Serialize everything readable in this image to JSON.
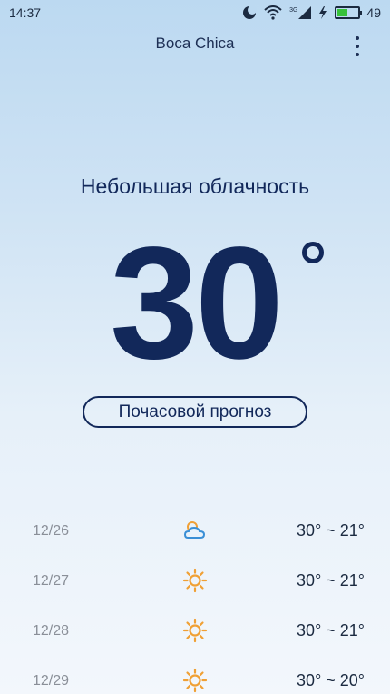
{
  "status_bar": {
    "time": "14:37",
    "network": "3G",
    "battery": "49",
    "battery_level": 0.49,
    "icons": [
      "moon-icon",
      "wifi-icon",
      "signal-icon",
      "charging-icon",
      "battery-icon"
    ]
  },
  "header": {
    "location": "Boca Chica",
    "menu_icon": "more-vertical-icon"
  },
  "current": {
    "condition": "Небольшая облачность",
    "temperature": "30"
  },
  "hourly_button": "Почасовой прогноз",
  "forecast": [
    {
      "date": "12/26",
      "icon": "partly-cloudy-icon",
      "range": "30° ~ 21°"
    },
    {
      "date": "12/27",
      "icon": "sun-icon",
      "range": "30° ~ 21°"
    },
    {
      "date": "12/28",
      "icon": "sun-icon",
      "range": "30° ~ 21°"
    },
    {
      "date": "12/29",
      "icon": "sun-icon",
      "range": "30° ~ 20°"
    }
  ],
  "colors": {
    "primary_text": "#12285a",
    "battery_fill": "#36c13a",
    "sun": "#f0a035",
    "cloud": "#3a8fd6"
  }
}
